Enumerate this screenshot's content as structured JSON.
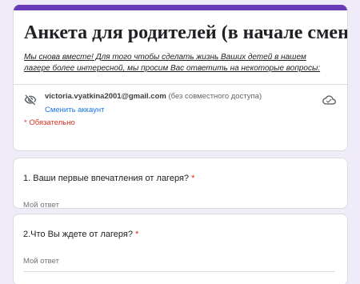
{
  "form": {
    "title": "Анкета для родителей (в начале смены)",
    "description": "Мы снова вместе! Для того чтобы сделать жизнь Ваших детей в нашем лагере более интересной, мы просим Вас ответить на некоторые вопросы:",
    "accent_color": "#673ab7"
  },
  "account": {
    "email": "victoria.vyatkina2001@gmail.com",
    "share_note": "(без совместного доступа)",
    "switch_label": "Сменить аккаунт",
    "icon_left": "visibility-off-icon",
    "icon_right": "cloud-saved-icon"
  },
  "required_note": "* Обязательно",
  "questions": [
    {
      "title": "1. Ваши первые впечатления от лагеря?",
      "required_mark": "*",
      "placeholder": "Мой ответ"
    },
    {
      "title": "2.Что Вы ждете от лагеря?",
      "required_mark": "*",
      "placeholder": "Мой ответ"
    }
  ]
}
